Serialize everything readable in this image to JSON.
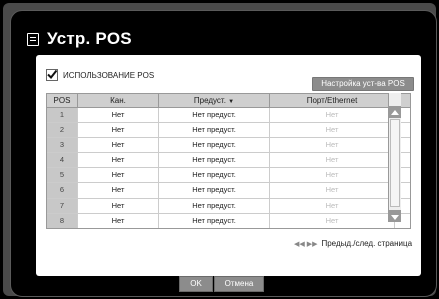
{
  "title": "Устр. POS",
  "use_pos_label": "ИСПОЛЬЗОВАНИЕ POS",
  "use_pos_checked": true,
  "setup_button": "Настройка уст-ва POS",
  "columns": [
    "POS",
    "Кан.",
    "Предуст.",
    "Порт/Ethernet"
  ],
  "rows": [
    {
      "pos": "1",
      "channel": "Нет",
      "preset": "Нет предуст.",
      "port": "Нет"
    },
    {
      "pos": "2",
      "channel": "Нет",
      "preset": "Нет предуст.",
      "port": "Нет"
    },
    {
      "pos": "3",
      "channel": "Нет",
      "preset": "Нет предуст.",
      "port": "Нет"
    },
    {
      "pos": "4",
      "channel": "Нет",
      "preset": "Нет предуст.",
      "port": "Нет"
    },
    {
      "pos": "5",
      "channel": "Нет",
      "preset": "Нет предуст.",
      "port": "Нет"
    },
    {
      "pos": "6",
      "channel": "Нет",
      "preset": "Нет предуст.",
      "port": "Нет"
    },
    {
      "pos": "7",
      "channel": "Нет",
      "preset": "Нет предуст.",
      "port": "Нет"
    },
    {
      "pos": "8",
      "channel": "Нет",
      "preset": "Нет предуст.",
      "port": "Нет"
    }
  ],
  "pager_label": "Предыд./след. страница",
  "ok_button": "OK",
  "cancel_button": "Отмена"
}
